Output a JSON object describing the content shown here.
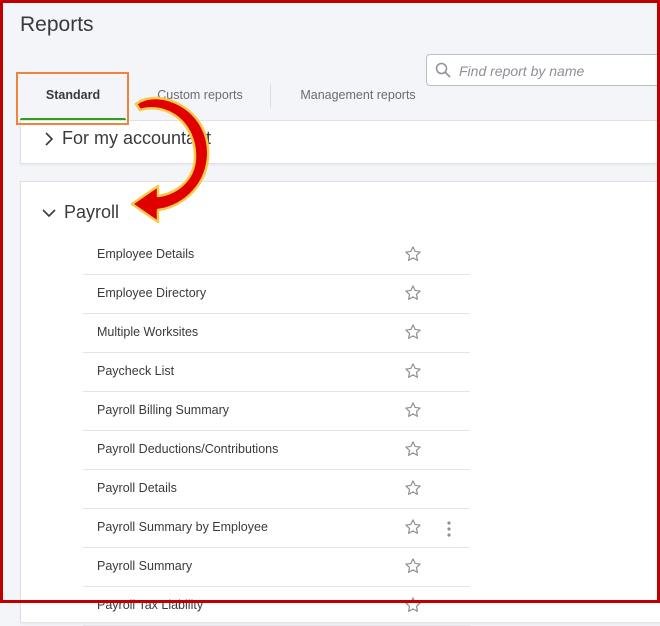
{
  "page": {
    "title": "Reports"
  },
  "search": {
    "placeholder": "Find report by name",
    "icon": "search-icon"
  },
  "tabs": [
    {
      "label": "Standard",
      "active": true
    },
    {
      "label": "Custom reports",
      "active": false
    },
    {
      "label": "Management reports",
      "active": false
    }
  ],
  "sections": {
    "accountant": {
      "label": "For my accountant",
      "expanded": false
    },
    "payroll": {
      "label": "Payroll",
      "expanded": true
    }
  },
  "payroll_reports": [
    {
      "name": "Employee Details"
    },
    {
      "name": "Employee Directory"
    },
    {
      "name": "Multiple Worksites"
    },
    {
      "name": "Paycheck List"
    },
    {
      "name": "Payroll Billing Summary"
    },
    {
      "name": "Payroll Deductions/Contributions"
    },
    {
      "name": "Payroll Details"
    },
    {
      "name": "Payroll Summary by Employee",
      "hovered": true
    },
    {
      "name": "Payroll Summary"
    },
    {
      "name": "Payroll Tax Liability"
    }
  ],
  "colors": {
    "active_tab_underline": "#2ca01c",
    "highlight_box": "#f0843c",
    "annotation_arrow": "#e00000",
    "frame": "#c00000"
  }
}
